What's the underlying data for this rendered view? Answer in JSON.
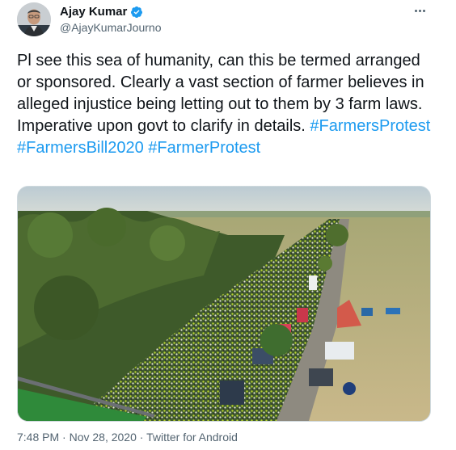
{
  "author": {
    "name": "Ajay Kumar",
    "handle": "@AjayKumarJourno",
    "verified": true
  },
  "tweet": {
    "text_parts": [
      "Pl  see this sea of humanity, can this be termed arranged or sponsored. Clearly a vast section of farmer believes in alleged injustice being letting out to them by 3 farm laws. Imperative upon govt to clarify in details. "
    ],
    "hashtags": [
      "#FarmersProtest",
      "#FarmersBill2020",
      "#FarmerProtest"
    ],
    "timestamp": "7:48 PM · Nov 28, 2020",
    "source_separator": " · ",
    "source": "Twitter for Android"
  },
  "icons": {
    "more": "more-horizontal-icon",
    "verified": "verified-badge-icon"
  },
  "colors": {
    "link": "#1d9bf0",
    "text": "#0f1419",
    "secondary": "#536471",
    "verified": "#1d9bf0"
  }
}
